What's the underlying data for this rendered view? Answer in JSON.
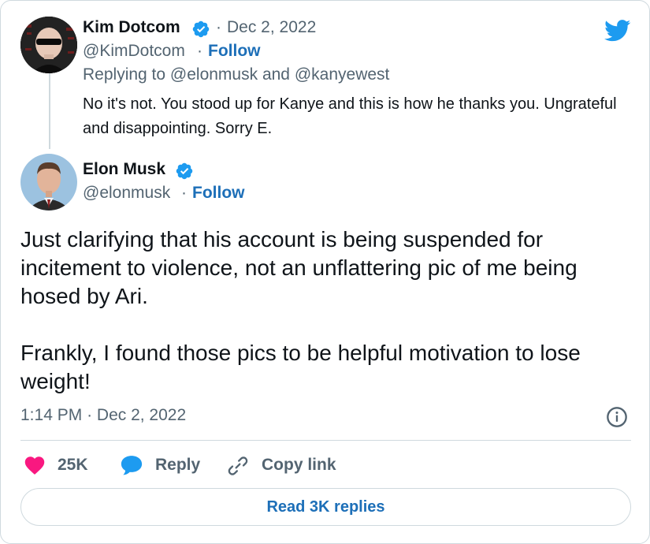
{
  "reply": {
    "author_name": "Kim Dotcom",
    "date": "Dec 2, 2022",
    "handle": "@KimDotcom",
    "follow_label": "Follow",
    "replying_prefix": "Replying to",
    "replying_user_1": "@elonmusk",
    "replying_and": "and",
    "replying_user_2": "@kanyewest",
    "text": "No it's not. You stood up for Kanye and this is how he thanks you. Ungrateful and disappointing. Sorry E."
  },
  "main": {
    "author_name": "Elon Musk",
    "handle": "@elonmusk",
    "follow_label": "Follow",
    "text": "Just clarifying that his account is being suspended for incitement to violence, not an unflattering pic of me being hosed by Ari.\n\nFrankly, I found those pics to be helpful motivation to lose weight!",
    "time": "1:14 PM",
    "date": "Dec 2, 2022"
  },
  "actions": {
    "like_count": "25K",
    "reply_label": "Reply",
    "copy_link_label": "Copy link",
    "read_replies_label": "Read 3K replies"
  },
  "separator": "·",
  "icons": {
    "brand": "twitter-bird-icon",
    "verified": "verified-badge-icon",
    "info": "info-icon",
    "like": "heart-icon",
    "reply": "speech-bubble-icon",
    "copy": "link-icon"
  },
  "colors": {
    "twitter_blue": "#1d9bf0",
    "link_blue": "#1d6fb8",
    "like_pink": "#f91880",
    "muted_gray": "#536471",
    "border": "#cfd9de"
  }
}
